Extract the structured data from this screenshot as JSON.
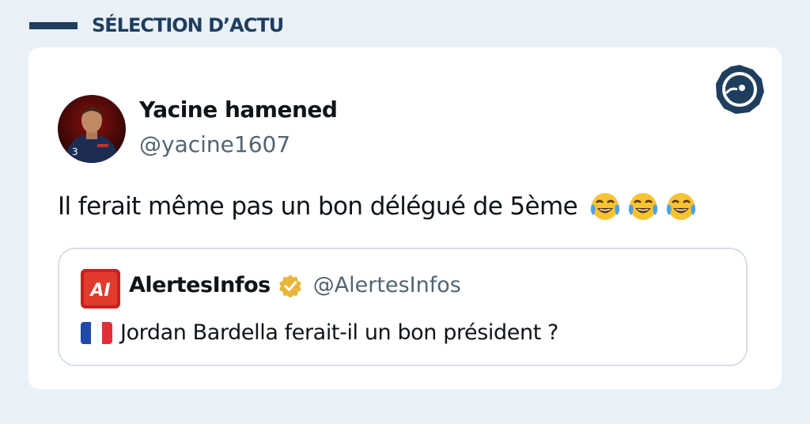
{
  "header": {
    "title": "SÉLECTION D’ACTU"
  },
  "tweet": {
    "author_name": "Yacine hamened",
    "author_handle": "@yacine1607",
    "text": "Il ferait même pas un bon délégué de 5ème",
    "emojis": [
      "face-with-tears-of-joy",
      "face-with-tears-of-joy",
      "face-with-tears-of-joy"
    ]
  },
  "quote": {
    "logo_text": "AI",
    "name": "AlertesInfos",
    "handle": "@AlertesInfos",
    "verified": true,
    "flag": "france-flag",
    "text": "Jordan Bardella ferait-il un bon président ?"
  },
  "colors": {
    "background": "#e9f0f8",
    "brand_navy": "#1f3e5e",
    "verified_gold": "#e8b63b",
    "alertes_red": "#c8211f"
  }
}
